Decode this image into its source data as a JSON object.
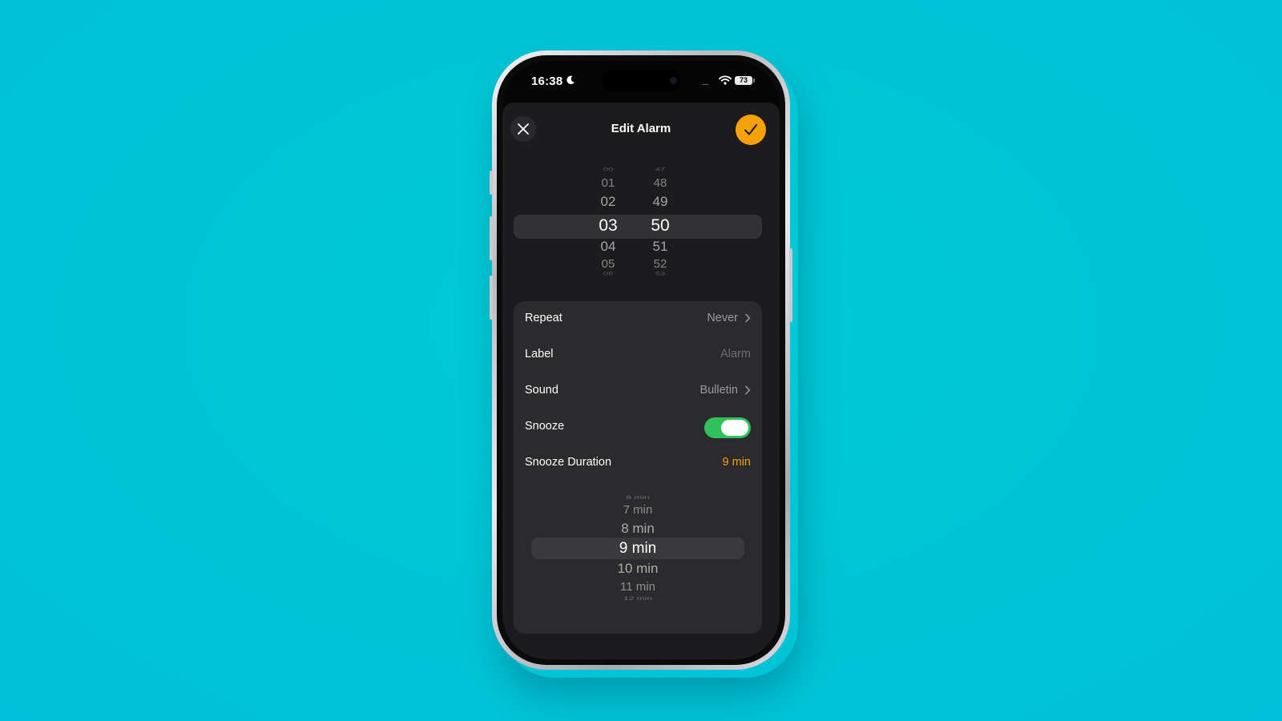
{
  "status_bar": {
    "time": "16:38",
    "battery": "73",
    "signal": "....",
    "icons": [
      "moon-icon",
      "wifi-icon",
      "battery-icon"
    ]
  },
  "header": {
    "title": "Edit Alarm",
    "close_icon": "close-icon",
    "confirm_icon": "checkmark-icon",
    "accent_color": "#f6a10a"
  },
  "time_picker": {
    "hours": [
      "00",
      "01",
      "02",
      "03",
      "04",
      "05",
      "06"
    ],
    "minutes": [
      "47",
      "48",
      "49",
      "50",
      "51",
      "52",
      "53"
    ],
    "selected_hour": "03",
    "selected_minute": "50"
  },
  "settings": {
    "repeat": {
      "label": "Repeat",
      "value": "Never"
    },
    "alarm_label": {
      "label": "Label",
      "placeholder": "Alarm"
    },
    "sound": {
      "label": "Sound",
      "value": "Bulletin"
    },
    "snooze": {
      "label": "Snooze",
      "enabled": true,
      "on_color": "#30c15a"
    },
    "snooze_duration": {
      "label": "Snooze Duration",
      "value": "9 min"
    }
  },
  "duration_picker": {
    "options": [
      "6 min",
      "7 min",
      "8 min",
      "9 min",
      "10 min",
      "11 min",
      "12 min"
    ],
    "selected": "9 min"
  }
}
